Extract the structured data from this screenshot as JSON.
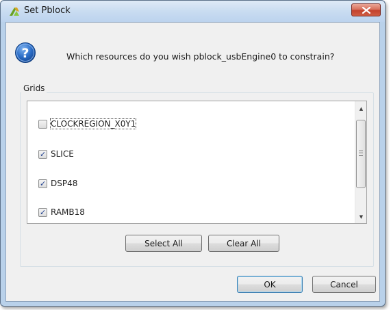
{
  "window": {
    "title": "Set Pblock"
  },
  "dialog": {
    "question": "Which resources do you wish pblock_usbEngine0 to constrain?",
    "group_label": "Grids",
    "items": [
      {
        "label": "CLOCKREGION_X0Y1",
        "checked": false
      },
      {
        "label": "SLICE",
        "checked": true
      },
      {
        "label": "DSP48",
        "checked": true
      },
      {
        "label": "RAMB18",
        "checked": true
      }
    ],
    "select_all_label": "Select All",
    "clear_all_label": "Clear All",
    "ok_label": "OK",
    "cancel_label": "Cancel"
  },
  "icons": {
    "app": "vivado-logo-icon",
    "close": "close-icon",
    "question": "question-icon"
  },
  "colors": {
    "title_bar": "#c9dcf1",
    "close_button": "#c3422d",
    "question_icon": "#1f5fb5",
    "checkmark": "#1e3f8f"
  }
}
